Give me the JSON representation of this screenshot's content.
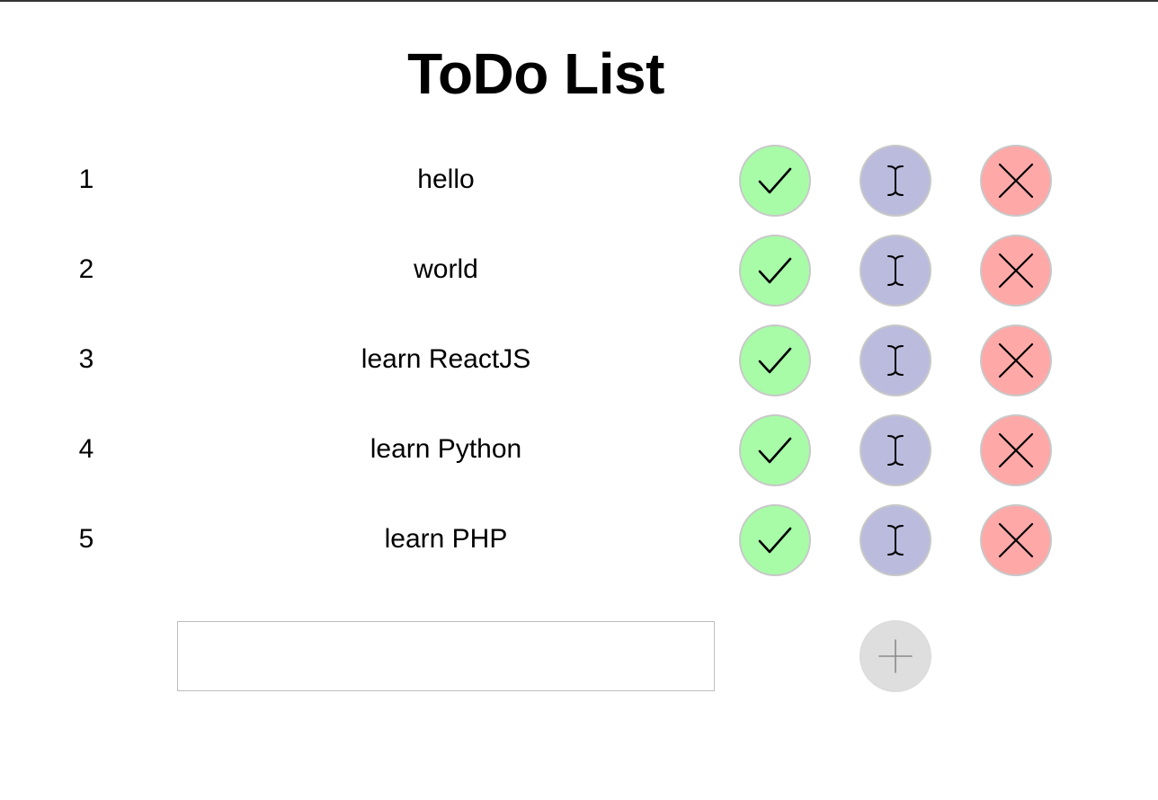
{
  "title": "ToDo List",
  "colors": {
    "done": "#a8fca8",
    "edit": "#bbbbdd",
    "delete": "#ffa8a8",
    "add": "#dedede"
  },
  "icons": {
    "done": "check-icon",
    "edit": "text-cursor-icon",
    "delete": "close-icon",
    "add": "plus-icon"
  },
  "todos": [
    {
      "number": "1",
      "text": "hello"
    },
    {
      "number": "2",
      "text": "world"
    },
    {
      "number": "3",
      "text": "learn ReactJS"
    },
    {
      "number": "4",
      "text": "learn Python"
    },
    {
      "number": "5",
      "text": "learn PHP"
    }
  ],
  "new_todo": {
    "value": "",
    "placeholder": ""
  }
}
